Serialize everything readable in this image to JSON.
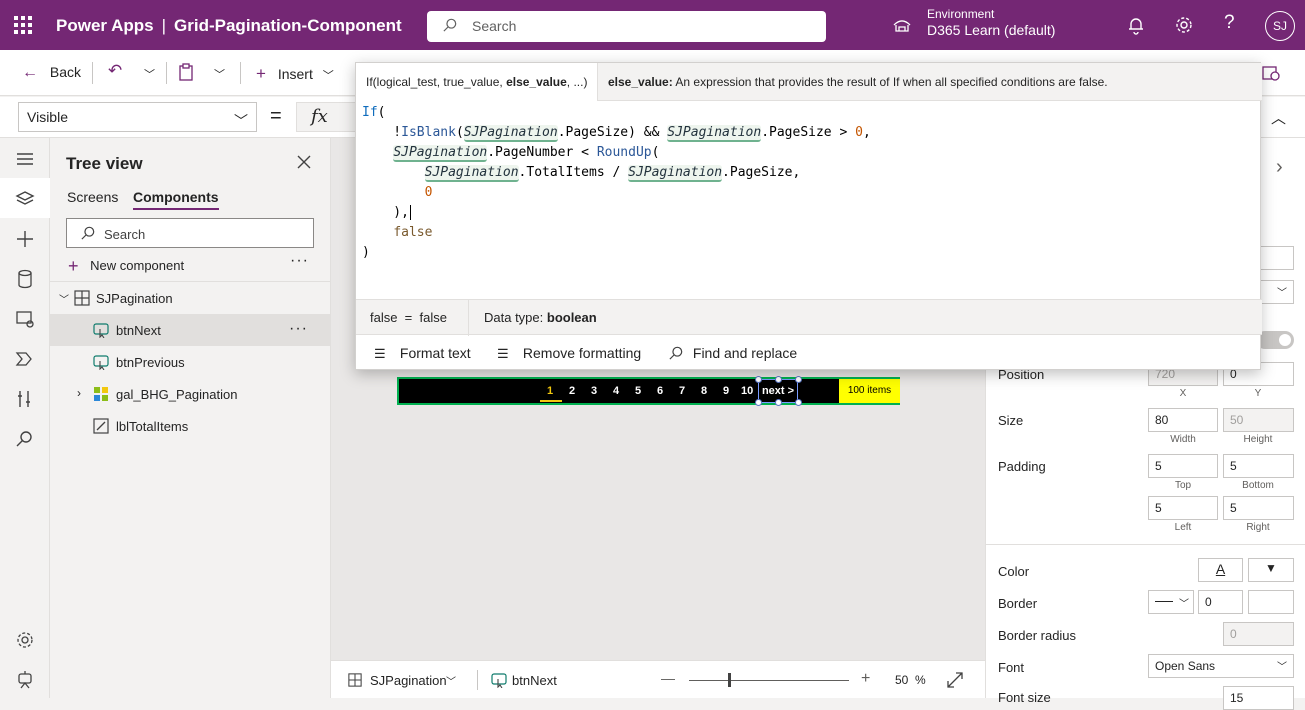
{
  "header": {
    "app_name": "Power Apps",
    "separator": "|",
    "doc_name": "Grid-Pagination-Component",
    "search_placeholder": "Search",
    "environment_label": "Environment",
    "environment_name": "D365 Learn (default)",
    "avatar_initials": "SJ"
  },
  "command_bar": {
    "back_label": "Back",
    "insert_label": "Insert"
  },
  "formula_bar": {
    "property": "Visible",
    "equals": "=",
    "fx": "fx"
  },
  "tree_view": {
    "title": "Tree view",
    "tabs": [
      "Screens",
      "Components"
    ],
    "active_tab": "Components",
    "search_placeholder": "Search",
    "new_component_label": "New component",
    "more": "···",
    "items": [
      {
        "label": "SJPagination",
        "type": "component"
      },
      {
        "label": "btnNext",
        "type": "button",
        "selected": true
      },
      {
        "label": "btnPrevious",
        "type": "button"
      },
      {
        "label": "gal_BHG_Pagination",
        "type": "gallery"
      },
      {
        "label": "lblTotalItems",
        "type": "label"
      }
    ]
  },
  "formula_popup": {
    "signature": "If(logical_test, true_value, ",
    "signature_bold": "else_value",
    "signature_tail": ", ...)",
    "param_name": "else_value:",
    "param_desc": " An expression that provides the result of If when all specified conditions are false.",
    "result": "false  =  false",
    "data_type_label": "Data type: ",
    "data_type_value": "boolean",
    "actions": [
      "Format text",
      "Remove formatting",
      "Find and replace"
    ]
  },
  "canvas": {
    "pages": [
      "1",
      "2",
      "3",
      "4",
      "5",
      "6",
      "7",
      "8",
      "9",
      "10"
    ],
    "active_page": "1",
    "next_label": "next >",
    "items_label": "100 items"
  },
  "status_bar": {
    "screen_label": "SJPagination",
    "control_label": "btnNext",
    "zoom_minus": "—",
    "zoom_plus": "+",
    "zoom_value": "50",
    "zoom_unit": "%"
  },
  "properties": {
    "position_label": "Position",
    "position_x": "720",
    "position_y": "0",
    "x_label": "X",
    "y_label": "Y",
    "size_label": "Size",
    "width": "80",
    "height": "50",
    "width_label": "Width",
    "height_label": "Height",
    "padding_label": "Padding",
    "padding_top": "5",
    "padding_bottom": "5",
    "padding_left": "5",
    "padding_right": "5",
    "top_label": "Top",
    "bottom_label": "Bottom",
    "left_label": "Left",
    "right_label": "Right",
    "color_label": "Color",
    "color_a": "A",
    "border_label": "Border",
    "border_width": "0",
    "border_radius_label": "Border radius",
    "border_radius": "0",
    "font_label": "Font",
    "font_value": "Open Sans",
    "font_size_label": "Font size",
    "font_size": "15"
  },
  "colors": {
    "brand": "#742774",
    "pager_border": "#00b050",
    "badge": "#ffff00"
  }
}
